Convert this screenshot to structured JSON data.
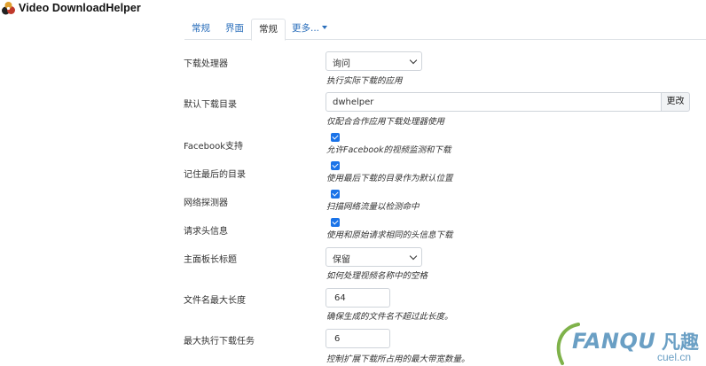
{
  "app": {
    "title": "Video DownloadHelper"
  },
  "tabs": [
    {
      "label": "常规",
      "active": false
    },
    {
      "label": "界面",
      "active": false
    },
    {
      "label": "常规",
      "active": true
    },
    {
      "label": "更多...",
      "active": false,
      "dropdown": true
    }
  ],
  "settings": {
    "download_handler": {
      "label": "下载处理器",
      "value": "询问",
      "help": "执行实际下载的应用"
    },
    "default_dir": {
      "label": "默认下载目录",
      "value": "dwhelper",
      "button": "更改",
      "help": "仅配合合作应用下载处理器使用"
    },
    "facebook": {
      "label": "Facebook支持",
      "checked": true,
      "help": "允许Facebook的视频监测和下载"
    },
    "remember_dir": {
      "label": "记住最后的目录",
      "checked": true,
      "help": "使用最后下载的目录作为默认位置"
    },
    "network_probe": {
      "label": "网络探测器",
      "checked": true,
      "help": "扫描网络流量以检测命中"
    },
    "headers": {
      "label": "请求头信息",
      "checked": true,
      "help": "使用和原始请求相同的头信息下载"
    },
    "title_spaces": {
      "label": "主面板长标题",
      "value": "保留",
      "help": "如何处理视频名称中的空格"
    },
    "max_filename": {
      "label": "文件名最大长度",
      "value": "64",
      "help": "确保生成的文件名不超过此长度。"
    },
    "max_tasks": {
      "label": "最大执行下载任务",
      "value": "6",
      "help": "控制扩展下载所占用的最大带宽数量。"
    }
  },
  "watermark": {
    "brand": "FANQU",
    "cn": "凡趣",
    "site": "cuel.cn"
  },
  "colors": {
    "link": "#2a6ebb",
    "checkbox": "#1a73e8",
    "watermark": "#6a9fc4"
  }
}
